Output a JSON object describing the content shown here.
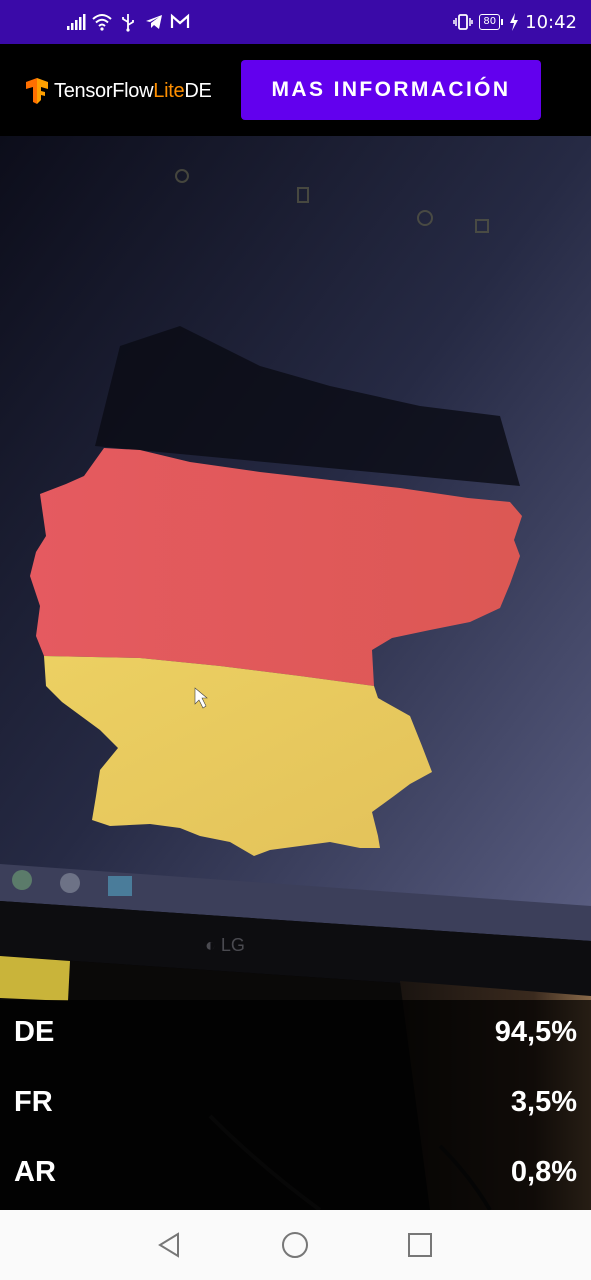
{
  "status_bar": {
    "time": "10:42",
    "battery_level": "80",
    "icons": [
      "signal-icon",
      "wifi-icon",
      "usb-icon",
      "telegram-icon",
      "gmail-icon",
      "vibrate-icon",
      "battery-icon",
      "charging-icon"
    ]
  },
  "toolbar": {
    "logo_prefix": "TensorFlow",
    "logo_lite": "Lite",
    "logo_suffix": "DE",
    "more_info_label": "MAS INFORMACIÓN"
  },
  "results": [
    {
      "label": "DE",
      "value": "94,5%"
    },
    {
      "label": "FR",
      "value": "3,5%"
    },
    {
      "label": "AR",
      "value": "0,8%"
    }
  ],
  "nav": {
    "icons": [
      "back-icon",
      "home-icon",
      "recents-icon"
    ]
  },
  "colors": {
    "status_bar": "#3a0aa8",
    "button": "#6200ee",
    "logo_orange": "#ff8f00",
    "flag_red": "#e05a5c",
    "flag_gold": "#e8c85a"
  }
}
